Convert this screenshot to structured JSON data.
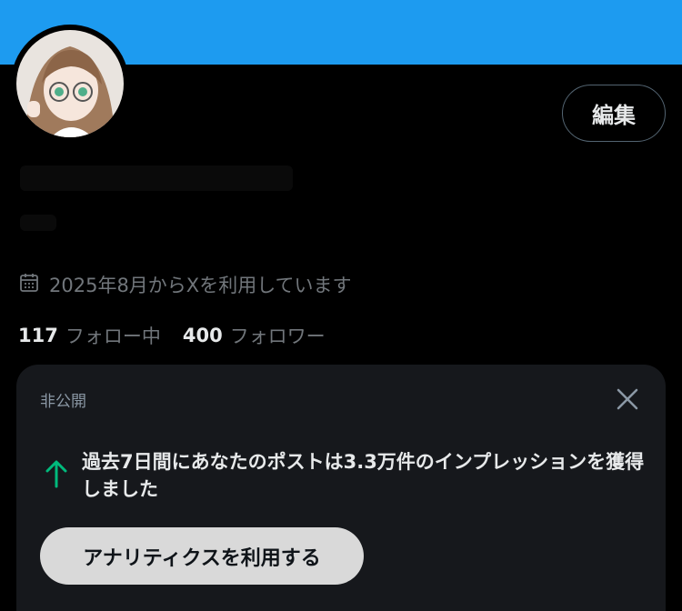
{
  "profile": {
    "edit_label": "編集",
    "joined_text": "2025年8月からXを利用しています",
    "following_count": "117",
    "following_label": "フォロー中",
    "followers_count": "400",
    "followers_label": "フォロワー"
  },
  "analytics_card": {
    "private_label": "非公開",
    "message": "過去7日間にあなたのポストは3.3万件のインプレッションを獲得しました",
    "button_label": "アナリティクスを利用する"
  },
  "icons": {
    "calendar": "calendar-icon",
    "close": "close-icon",
    "trend_up": "arrow-up-icon"
  },
  "colors": {
    "banner": "#1d9bf0",
    "background": "#000000",
    "card": "#16181c",
    "accent_green": "#00ba7c",
    "muted_text": "#71767b"
  }
}
